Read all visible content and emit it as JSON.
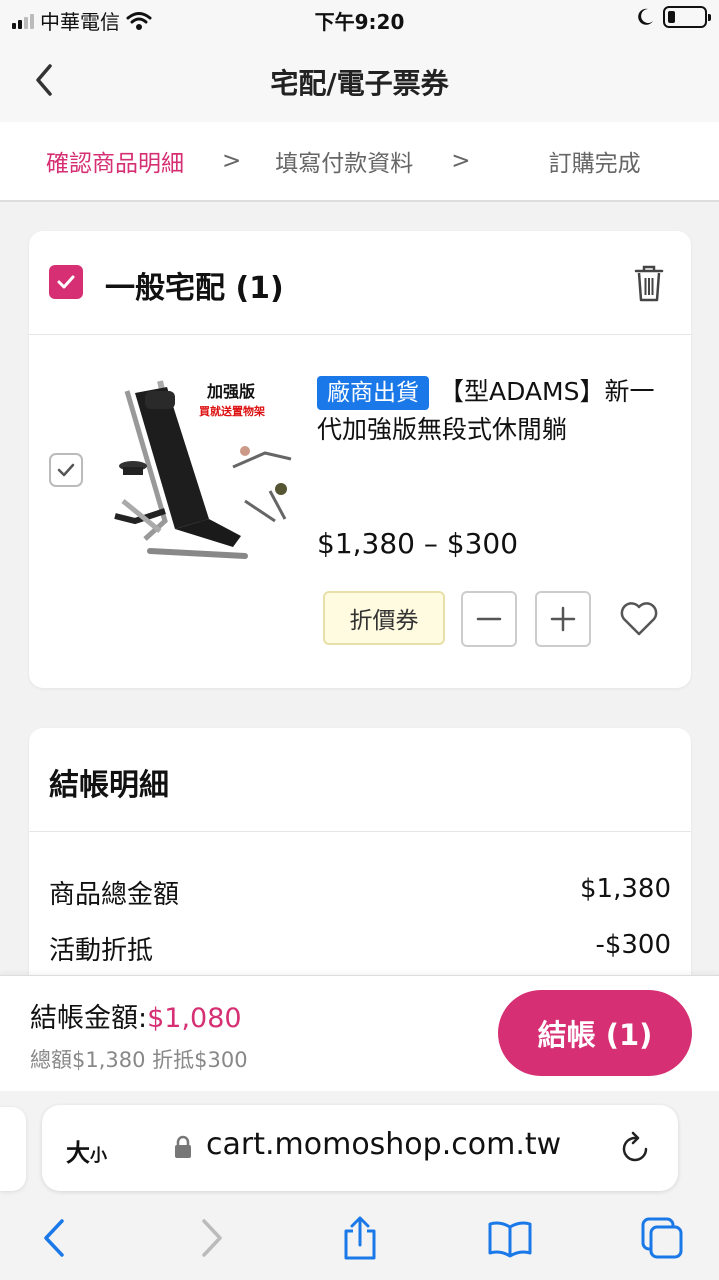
{
  "status_bar": {
    "carrier": "中華電信",
    "time": "下午9:20"
  },
  "nav": {
    "title": "宅配/電子票券"
  },
  "steps": [
    {
      "label": "確認商品明細",
      "active": true
    },
    {
      "label": "填寫付款資料",
      "active": false
    },
    {
      "label": "訂購完成",
      "active": false
    }
  ],
  "step_separator": ">",
  "cart_group": {
    "title": "一般宅配 (1)",
    "item": {
      "image_caption_1": "加强版",
      "image_caption_2": "買就送置物架",
      "tag": "廠商出貨",
      "name": "【型ADAMS】新一代加強版無段式休閒躺",
      "price": "$1,380 – $300",
      "coupon_label": "折價券"
    }
  },
  "summary": {
    "title": "結帳明細",
    "rows": [
      {
        "label": "商品總金額",
        "value": "$1,380"
      },
      {
        "label": "活動折抵",
        "value": "-$300"
      }
    ]
  },
  "checkout": {
    "amount_label": "結帳金額:",
    "amount_value": "$1,080",
    "sub": "總額$1,380 折抵$300",
    "button": "結帳 (1)"
  },
  "safari": {
    "text_size_big": "大",
    "text_size_small": "小",
    "url": "cart.momoshop.com.tw"
  },
  "colors": {
    "accent": "#d62f73",
    "tag_blue": "#1a78e8"
  }
}
